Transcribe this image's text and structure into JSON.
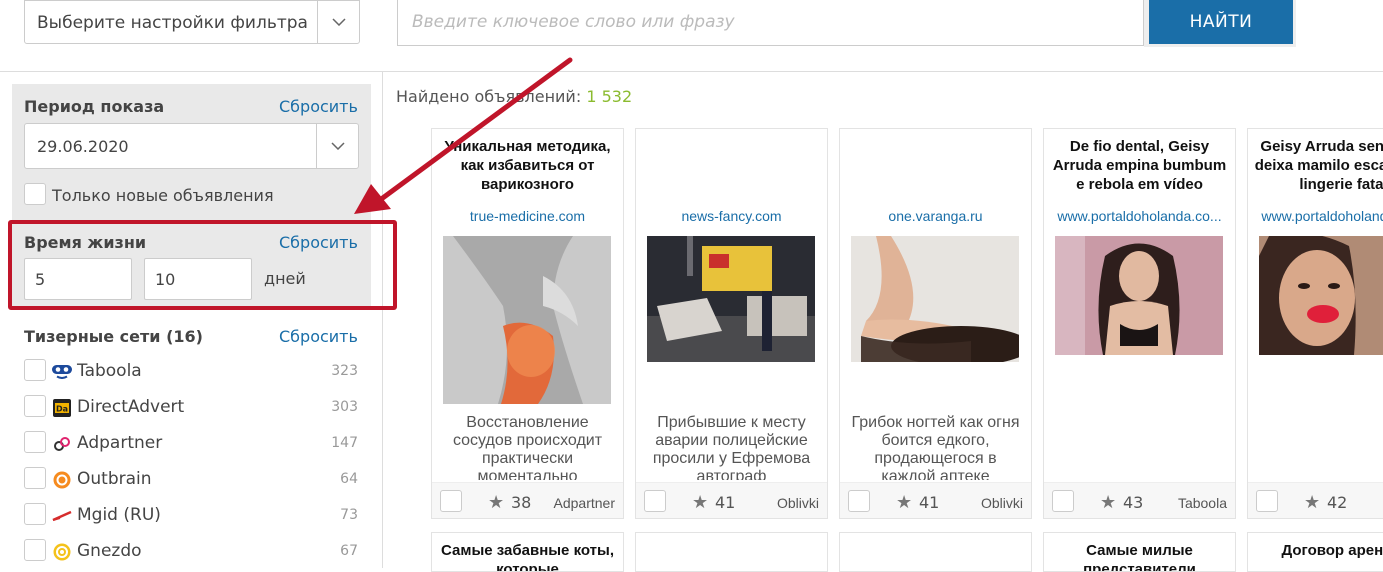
{
  "header": {
    "filter_placeholder": "Выберите настройки фильтра",
    "search_placeholder": "Введите ключевое слово или фразу",
    "search_button": "НАЙТИ"
  },
  "sidebar": {
    "period": {
      "title": "Период показа",
      "reset": "Сбросить",
      "date": "29.06.2020",
      "only_new_label": "Только новые объявления"
    },
    "lifetime": {
      "title": "Время жизни",
      "reset": "Сбросить",
      "from": "5",
      "to": "10",
      "unit": "дней"
    },
    "networks": {
      "title": "Тизерные сети (16)",
      "reset": "Сбросить",
      "items": [
        {
          "name": "Taboola",
          "count": "323",
          "icon": "taboola-icon"
        },
        {
          "name": "DirectAdvert",
          "count": "303",
          "icon": "directadvert-icon"
        },
        {
          "name": "Adpartner",
          "count": "147",
          "icon": "adpartner-icon"
        },
        {
          "name": "Outbrain",
          "count": "64",
          "icon": "outbrain-icon"
        },
        {
          "name": "Mgid (RU)",
          "count": "73",
          "icon": "mgid-icon"
        },
        {
          "name": "Gnezdo",
          "count": "67",
          "icon": "gnezdo-icon"
        }
      ]
    }
  },
  "results": {
    "found_label": "Найдено объявлений:",
    "found_count": "1 532",
    "cards": [
      {
        "title": "Уникальная методика, как избавиться от варикозного",
        "domain": "true-medicine.com",
        "desc": "Восстановление сосудов происходит практически моментально",
        "rating": "38",
        "network": "Adpartner"
      },
      {
        "title": "",
        "domain": "news-fancy.com",
        "desc": "Прибывшие к месту аварии полицейские просили у Ефремова автограф",
        "rating": "41",
        "network": "Oblivki"
      },
      {
        "title": "",
        "domain": "one.varanga.ru",
        "desc": "Грибок ногтей как огня боится едкого, продающегося в каждой аптеке",
        "rating": "41",
        "network": "Oblivki"
      },
      {
        "title": "De fio dental, Geisy Arruda empina bumbum e rebola em vídeo",
        "domain": "www.portaldoholanda.co...",
        "desc": "",
        "rating": "43",
        "network": "Taboola"
      },
      {
        "title": "Geisy Arruda sensual e deixa mamilo escapar de lingerie fatal",
        "domain": "www.portaldoholanda.com",
        "desc": "",
        "rating": "42",
        "network": ""
      }
    ],
    "second_row_titles": [
      "Самые забавные коты, которые",
      "",
      "",
      "Самые милые представители",
      "Договор аренды"
    ]
  },
  "colors": {
    "accent": "#1a6ea8",
    "highlight": "#c0152a",
    "found_count": "#8bbb2f"
  }
}
